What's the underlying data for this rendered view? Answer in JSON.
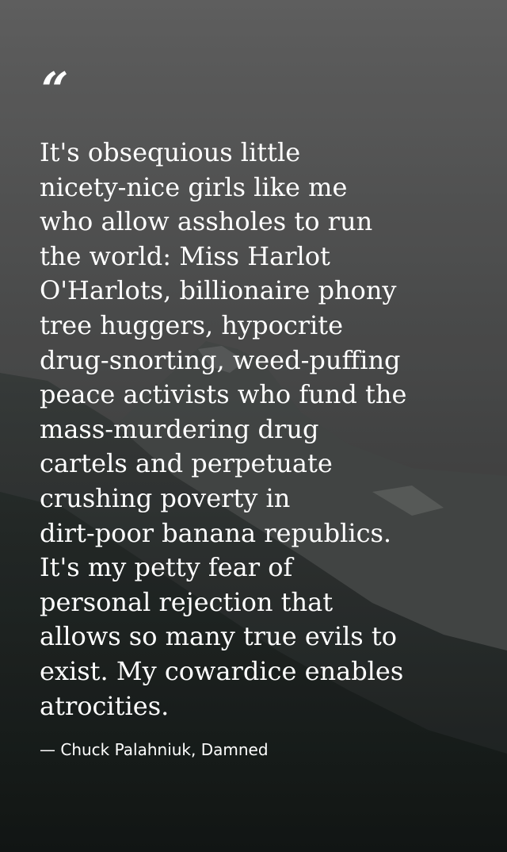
{
  "quote": {
    "mark": "“",
    "text": "It's obsequious little\nnicety-nice girls like me\nwho allow assholes to run\nthe world: Miss Harlot\nO'Harlots, billionaire phony\ntree huggers, hypocrite\ndrug-snorting, weed-puffing\npeace activists who fund the\nmass-murdering drug\ncartels and perpetuate\ncrushing poverty in\ndirt-poor banana republics.\nIt's my petty fear of\npersonal rejection that\nallows so many true evils to\nexist. My cowardice enables\natrocities.",
    "attribution": "— Chuck Palahniuk, Damned"
  },
  "colors": {
    "text": "#ffffff",
    "background_top": "#6a6a6a",
    "background_bottom": "#1e2322"
  },
  "background": {
    "scene": "mountain-forest-photo"
  }
}
